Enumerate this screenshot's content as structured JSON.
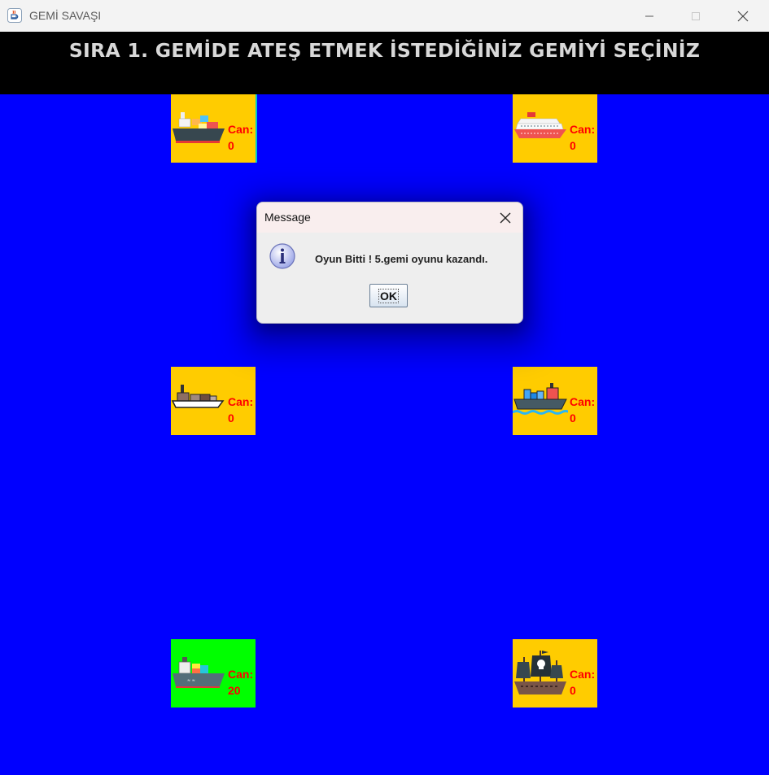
{
  "window": {
    "title": "GEMİ SAVAŞI"
  },
  "header": {
    "text": "SIRA 1. GEMİDE ATEŞ ETMEK İSTEDİĞİNİZ GEMİYİ SEÇİNİZ"
  },
  "ships": [
    {
      "id": "ship-1",
      "icon": "cargo-ship-icon",
      "can_label": "Can:",
      "can_value": "0",
      "color": "#ffcc00"
    },
    {
      "id": "ship-2",
      "icon": "cruise-ship-icon",
      "can_label": "Can:",
      "can_value": "0",
      "color": "#ffcc00"
    },
    {
      "id": "ship-3",
      "icon": "barge-ship-icon",
      "can_label": "Can:",
      "can_value": "0",
      "color": "#ffcc00"
    },
    {
      "id": "ship-4",
      "icon": "container-ship-icon",
      "can_label": "Can:",
      "can_value": "0",
      "color": "#ffcc00"
    },
    {
      "id": "ship-5",
      "icon": "tanker-ship-icon",
      "can_label": "Can:",
      "can_value": "20",
      "color": "#00ff00"
    },
    {
      "id": "ship-6",
      "icon": "pirate-ship-icon",
      "can_label": "Can:",
      "can_value": "0",
      "color": "#ffcc00"
    }
  ],
  "dialog": {
    "title": "Message",
    "icon": "info-icon",
    "message": "Oyun Bitti ! 5.gemi oyunu kazandı.",
    "ok_label": "OK"
  },
  "colors": {
    "sea": "#0000ff",
    "header_bg": "#000000",
    "header_text": "#d8d8d8",
    "can_text": "#ff0000"
  }
}
